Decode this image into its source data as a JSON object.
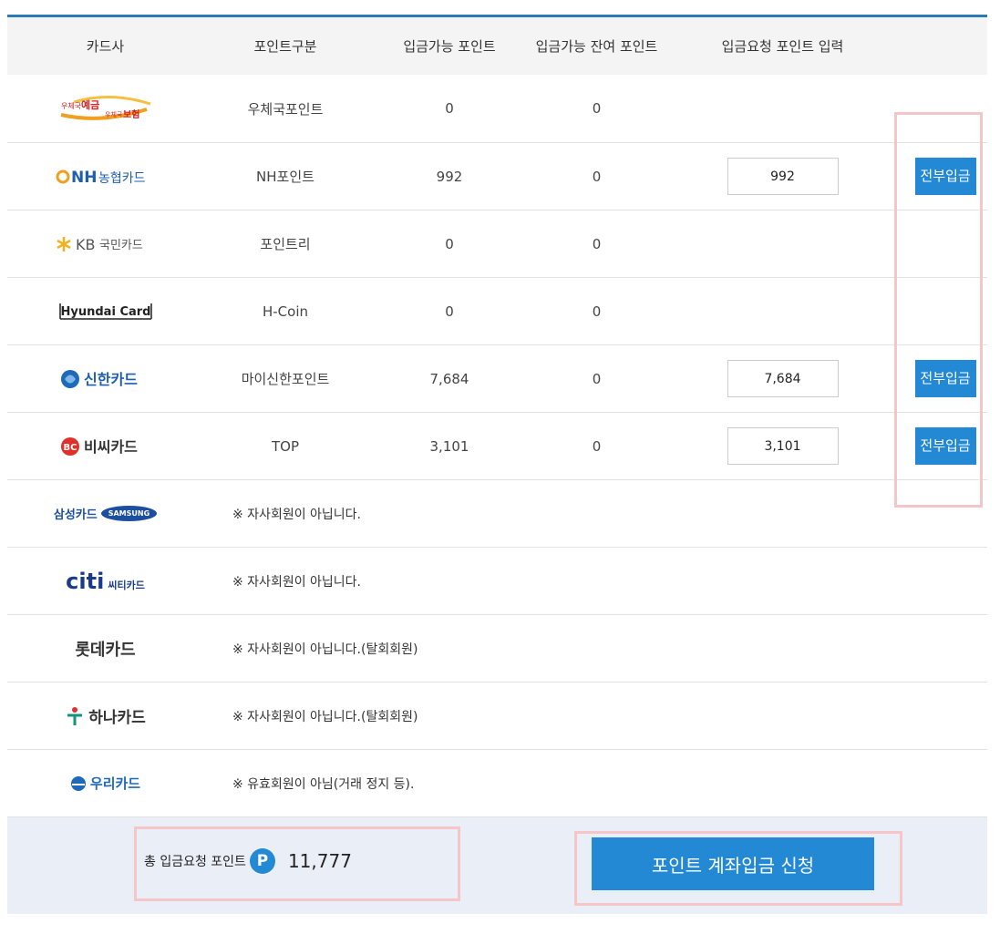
{
  "headers": [
    "카드사",
    "포인트구분",
    "입금가능 포인트",
    "입금가능 잔여 포인트",
    "입금요청 포인트 입력"
  ],
  "rows": [
    {
      "logo": "우체국 예금 우체국 보험",
      "type": "우체국포인트",
      "available": "0",
      "remaining": "0"
    },
    {
      "logo": "NH농협카드",
      "type": "NH포인트",
      "available": "992",
      "remaining": "0",
      "request": "992",
      "button": "전부입금"
    },
    {
      "logo": "KB국민카드",
      "type": "포인트리",
      "available": "0",
      "remaining": "0"
    },
    {
      "logo": "Hyundai Card",
      "type": "H-Coin",
      "available": "0",
      "remaining": "0"
    },
    {
      "logo": "신한카드",
      "type": "마이신한포인트",
      "available": "7,684",
      "remaining": "0",
      "request": "7,684",
      "button": "전부입금"
    },
    {
      "logo": "비씨카드",
      "type": "TOP",
      "available": "3,101",
      "remaining": "0",
      "request": "3,101",
      "button": "전부입금"
    }
  ],
  "nonmembers": [
    {
      "logo_text": "삼성카드",
      "logo_badge": "SAMSUNG",
      "note": "※ 자사회원이 아닙니다."
    },
    {
      "logo_text": "citi",
      "logo_sub": "씨티카드",
      "note": "※ 자사회원이 아닙니다."
    },
    {
      "logo_text": "롯데카드",
      "note": "※ 자사회원이 아닙니다.(탈회회원)"
    },
    {
      "logo_text": "하나카드",
      "note": "※ 자사회원이 아닙니다.(탈회회원)"
    },
    {
      "logo_text": "우리카드",
      "note": "※ 유효회원이 아님(거래 정지 등)."
    }
  ],
  "footer": {
    "total_label": "총 입금요청 포인트",
    "badge": "P",
    "total_value": "11,777",
    "submit_label": "포인트 계좌입금 신청"
  },
  "colors": {
    "accent": "#2389d4",
    "highlight": "#f6c5c8",
    "footer_bg": "#eaeff7"
  }
}
